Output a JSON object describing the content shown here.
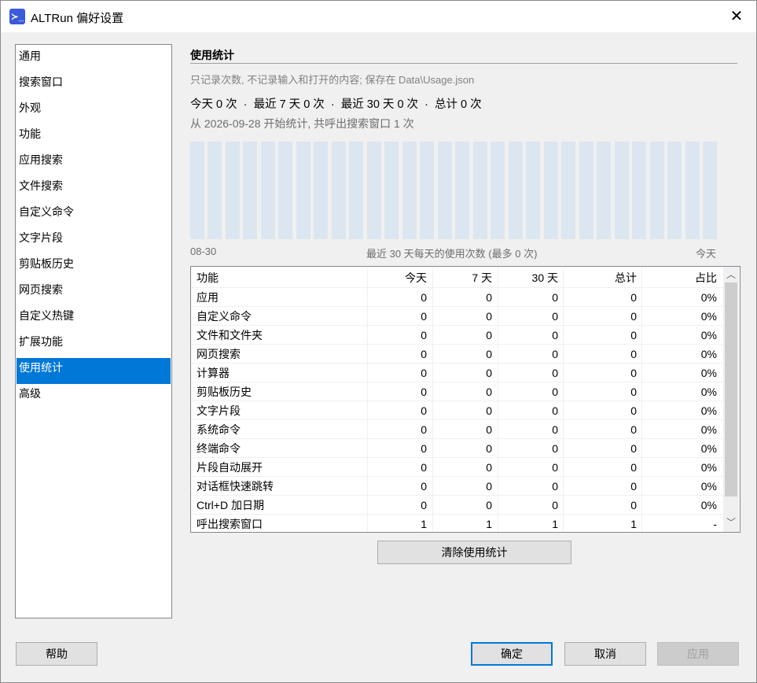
{
  "window": {
    "title": "ALTRun 偏好设置",
    "icon_glyph": "≻_",
    "close_glyph": "✕"
  },
  "sidebar": {
    "items": [
      {
        "label": "通用"
      },
      {
        "label": "搜索窗口"
      },
      {
        "label": "外观"
      },
      {
        "label": "功能"
      },
      {
        "label": "应用搜索"
      },
      {
        "label": "文件搜索"
      },
      {
        "label": "自定义命令"
      },
      {
        "label": "文字片段"
      },
      {
        "label": "剪贴板历史"
      },
      {
        "label": "网页搜索"
      },
      {
        "label": "自定义热键"
      },
      {
        "label": "扩展功能"
      },
      {
        "label": "使用统计"
      },
      {
        "label": "高级"
      }
    ],
    "selected": "使用统计"
  },
  "usage": {
    "title": "使用统计",
    "hint": "只记录次数, 不记录输入和打开的内容; 保存在 Data\\Usage.json",
    "summary": "今天 0 次  ·  最近 7 天 0 次  ·  最近 30 天 0 次  ·  总计 0 次",
    "since": "从 2026-09-28 开始统计, 共呼出搜索窗口 1 次",
    "axis_start": "08-30",
    "axis_caption": "最近 30 天每天的使用次数 (最多 0 次)",
    "axis_end": "今天",
    "daily_counts": [
      0,
      0,
      0,
      0,
      0,
      0,
      0,
      0,
      0,
      0,
      0,
      0,
      0,
      0,
      0,
      0,
      0,
      0,
      0,
      0,
      0,
      0,
      0,
      0,
      0,
      0,
      0,
      0,
      0,
      0
    ],
    "columns": [
      "功能",
      "今天",
      "7 天",
      "30 天",
      "总计",
      "占比"
    ],
    "rows": [
      {
        "feature": "应用",
        "today": "0",
        "d7": "0",
        "d30": "0",
        "total": "0",
        "share": "0%"
      },
      {
        "feature": "自定义命令",
        "today": "0",
        "d7": "0",
        "d30": "0",
        "total": "0",
        "share": "0%"
      },
      {
        "feature": "文件和文件夹",
        "today": "0",
        "d7": "0",
        "d30": "0",
        "total": "0",
        "share": "0%"
      },
      {
        "feature": "网页搜索",
        "today": "0",
        "d7": "0",
        "d30": "0",
        "total": "0",
        "share": "0%"
      },
      {
        "feature": "计算器",
        "today": "0",
        "d7": "0",
        "d30": "0",
        "total": "0",
        "share": "0%"
      },
      {
        "feature": "剪贴板历史",
        "today": "0",
        "d7": "0",
        "d30": "0",
        "total": "0",
        "share": "0%"
      },
      {
        "feature": "文字片段",
        "today": "0",
        "d7": "0",
        "d30": "0",
        "total": "0",
        "share": "0%"
      },
      {
        "feature": "系统命令",
        "today": "0",
        "d7": "0",
        "d30": "0",
        "total": "0",
        "share": "0%"
      },
      {
        "feature": "终端命令",
        "today": "0",
        "d7": "0",
        "d30": "0",
        "total": "0",
        "share": "0%"
      },
      {
        "feature": "片段自动展开",
        "today": "0",
        "d7": "0",
        "d30": "0",
        "total": "0",
        "share": "0%"
      },
      {
        "feature": "对话框快速跳转",
        "today": "0",
        "d7": "0",
        "d30": "0",
        "total": "0",
        "share": "0%"
      },
      {
        "feature": "Ctrl+D 加日期",
        "today": "0",
        "d7": "0",
        "d30": "0",
        "total": "0",
        "share": "0%"
      },
      {
        "feature": "呼出搜索窗口",
        "today": "1",
        "d7": "1",
        "d30": "1",
        "total": "1",
        "share": "-"
      }
    ],
    "scroll_up_glyph": "︿",
    "scroll_down_glyph": "﹀",
    "clear_button": "清除使用统计"
  },
  "footer": {
    "help": "帮助",
    "ok": "确定",
    "cancel": "取消",
    "apply": "应用"
  },
  "colors": {
    "accent": "#0078d7",
    "bar": "#dce6f0",
    "icon": "#3b5bdb"
  }
}
